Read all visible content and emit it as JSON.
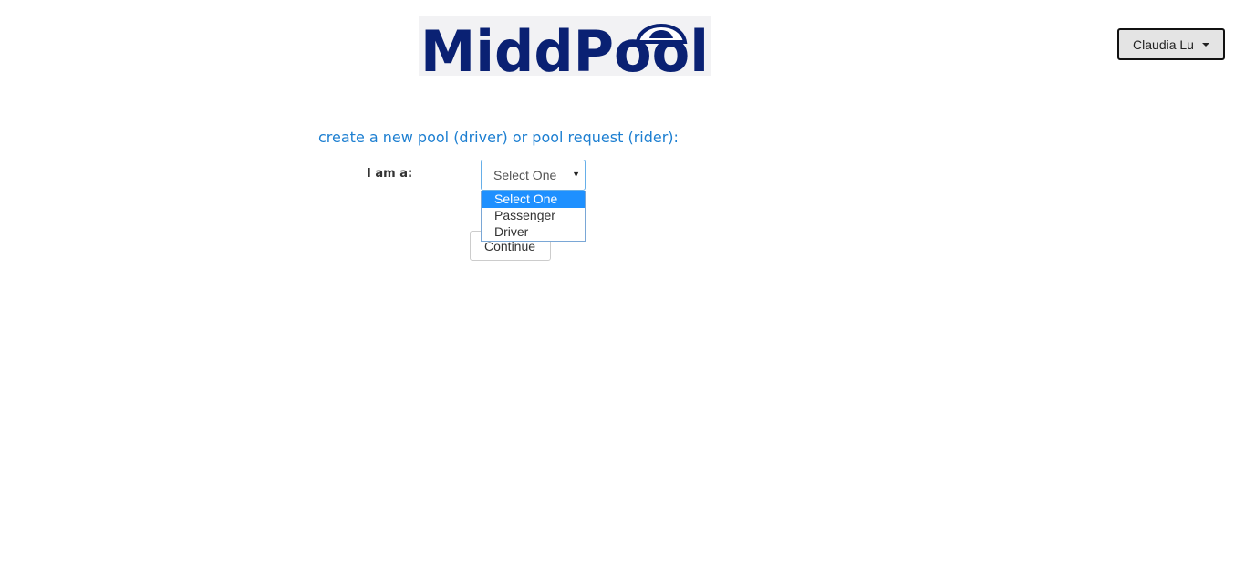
{
  "header": {
    "logo_text": "MiddPool",
    "user_menu_label": "Claudia Lu"
  },
  "form": {
    "heading": "create a new pool (driver) or pool request (rider):",
    "role_label": "I am a:",
    "role_select": {
      "selected": "Select One",
      "options": [
        "Select One",
        "Passenger",
        "Driver"
      ]
    },
    "continue_label": "Continue"
  },
  "colors": {
    "logo_navy": "#0a2173",
    "heading_blue": "#1d7fd1",
    "option_highlight": "#1e90ff"
  }
}
